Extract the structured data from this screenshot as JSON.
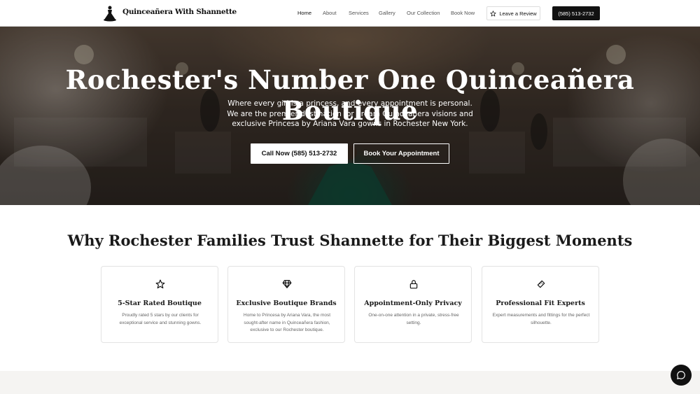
{
  "header": {
    "brand": "Quinceañera With Shannette",
    "nav": [
      "Home",
      "About",
      "Services",
      "Gallery",
      "Our Collection",
      "Book Now"
    ],
    "active_nav": "Home",
    "review_label": "Leave a Review",
    "phone_label": "(585) 513-2732"
  },
  "hero": {
    "title": "Rochester's Number One Quinceañera Boutique",
    "subtitle": "Where every girl is a princess, and every appointment is personal. We are the premier destination for dream Quinceañera visions and exclusive Princesa by Ariana Vara gowns in Rochester New York.",
    "call_label": "Call Now (585) 513-2732",
    "book_label": "Book Your Appointment"
  },
  "why": {
    "title": "Why Rochester Families Trust Shannette for Their Biggest Moments",
    "cards": [
      {
        "icon": "star-icon",
        "title": "5-Star Rated Boutique",
        "text": "Proudly rated 5 stars by our clients for exceptional service and stunning gowns."
      },
      {
        "icon": "diamond-icon",
        "title": "Exclusive Boutique Brands",
        "text": "Home to Princesa by Ariana Vara, the most sought-after name in Quinceañera fashion, exclusive to our Rochester boutique."
      },
      {
        "icon": "lock-icon",
        "title": "Appointment-Only Privacy",
        "text": "One-on-one attention in a private, stress-free setting."
      },
      {
        "icon": "ruler-icon",
        "title": "Professional Fit Experts",
        "text": "Expert measurements and fittings for the perfect silhouette."
      }
    ]
  },
  "colors": {
    "accent": "#111111",
    "background": "#ffffff",
    "muted": "#666666"
  }
}
